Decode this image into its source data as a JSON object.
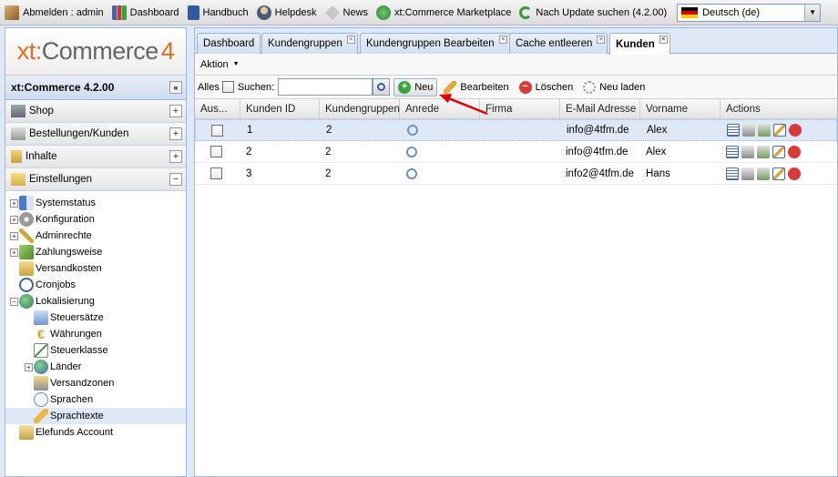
{
  "topbar": {
    "items": [
      {
        "label": "Abmelden : admin",
        "icon": "logout-icon",
        "color": "#b07b3b"
      },
      {
        "label": "Dashboard",
        "icon": "dashboard-chart-icon",
        "color": "#4a72c4"
      },
      {
        "label": "Handbuch",
        "icon": "book-icon",
        "color": "#345a9c"
      },
      {
        "label": "Helpdesk",
        "icon": "helpdesk-user-icon",
        "color": "#7a6a52"
      },
      {
        "label": "News",
        "icon": "news-tag-icon",
        "color": "#9a9a9a"
      },
      {
        "label": "xt:Commerce Marketplace",
        "icon": "marketplace-globe-icon",
        "color": "#3b9a4b"
      },
      {
        "label": "Nach Update suchen (4.2.00)",
        "icon": "refresh-icon",
        "color": "#3a9a3a"
      }
    ],
    "language": "Deutsch (de)"
  },
  "sidebar": {
    "logo": {
      "x": "xt",
      "colon": ":",
      "rest": "Commerce",
      "four": "4"
    },
    "title": "xt:Commerce 4.2.00",
    "accordions": [
      {
        "label": "Shop",
        "icon": "shop-icon"
      },
      {
        "label": "Bestellungen/Kunden",
        "icon": "orders-customers-icon"
      },
      {
        "label": "Inhalte",
        "icon": "content-icon"
      },
      {
        "label": "Einstellungen",
        "icon": "settings-folder-icon"
      }
    ],
    "tree": [
      {
        "label": "Systemstatus",
        "level": 0,
        "expander": "+",
        "icon": "systemstatus-icon"
      },
      {
        "label": "Konfiguration",
        "level": 0,
        "expander": "+",
        "icon": "configuration-gear-icon"
      },
      {
        "label": "Adminrechte",
        "level": 0,
        "expander": "+",
        "icon": "admin-key-icon"
      },
      {
        "label": "Zahlungsweise",
        "level": 0,
        "expander": "+",
        "icon": "payment-icon"
      },
      {
        "label": "Versandkosten",
        "level": 0,
        "expander": "",
        "icon": "shipping-box-icon"
      },
      {
        "label": "Cronjobs",
        "level": 0,
        "expander": "",
        "icon": "cronjobs-clock-icon"
      },
      {
        "label": "Lokalisierung",
        "level": 0,
        "expander": "−",
        "icon": "localization-globe-icon"
      },
      {
        "label": "Steuersätze",
        "level": 1,
        "expander": "",
        "icon": "tax-rates-icon"
      },
      {
        "label": "Währungen",
        "level": 1,
        "expander": "",
        "icon": "currency-euro-icon"
      },
      {
        "label": "Steuerklasse",
        "level": 1,
        "expander": "",
        "icon": "tax-class-icon"
      },
      {
        "label": "Länder",
        "level": 1,
        "expander": "+",
        "icon": "countries-globe-icon"
      },
      {
        "label": "Versandzonen",
        "level": 1,
        "expander": "",
        "icon": "shipping-zones-icon"
      },
      {
        "label": "Sprachen",
        "level": 1,
        "expander": "",
        "icon": "languages-speech-icon"
      },
      {
        "label": "Sprachtexte",
        "level": 1,
        "expander": "",
        "icon": "language-texts-pencil-icon",
        "selected": true
      },
      {
        "label": "Elefunds Account",
        "level": 0,
        "expander": "",
        "icon": "elefunds-account-icon"
      }
    ]
  },
  "tabs": [
    {
      "label": "Dashboard",
      "closable": false
    },
    {
      "label": "Kundengruppen",
      "closable": true
    },
    {
      "label": "Kundengruppen Bearbeiten",
      "closable": true
    },
    {
      "label": "Cache entleeren",
      "closable": true
    },
    {
      "label": "Kunden",
      "closable": true,
      "active": true
    }
  ],
  "toolbar": {
    "action_label": "Aktion",
    "all_label": "Alles",
    "search_label": "Suchen:",
    "search_value": "",
    "new_label": "Neu",
    "edit_label": "Bearbeiten",
    "delete_label": "Löschen",
    "reload_label": "Neu laden"
  },
  "grid": {
    "columns": [
      "Aus...",
      "Kunden ID",
      "Kundengruppen",
      "Anrede",
      "Firma",
      "E-Mail Adresse",
      "Vorname",
      "Actions"
    ],
    "rows": [
      {
        "id": "1",
        "group": "2",
        "anrede": "male",
        "firma": "",
        "email": "info@4tfm.de",
        "vorname": "Alex",
        "selected": true
      },
      {
        "id": "2",
        "group": "2",
        "anrede": "male",
        "firma": "",
        "email": "info@4tfm.de",
        "vorname": "Alex"
      },
      {
        "id": "3",
        "group": "2",
        "anrede": "male",
        "firma": "",
        "email": "info2@4tfm.de",
        "vorname": "Hans"
      }
    ],
    "row_actions": [
      "details-icon",
      "print-icon",
      "add-address-icon",
      "edit-icon",
      "delete-icon"
    ]
  },
  "colors": {
    "accent_orange": "#e36f1e",
    "panel_border": "#99bbe8",
    "selection": "#dfe8f6",
    "annotation_arrow": "#e00000"
  }
}
